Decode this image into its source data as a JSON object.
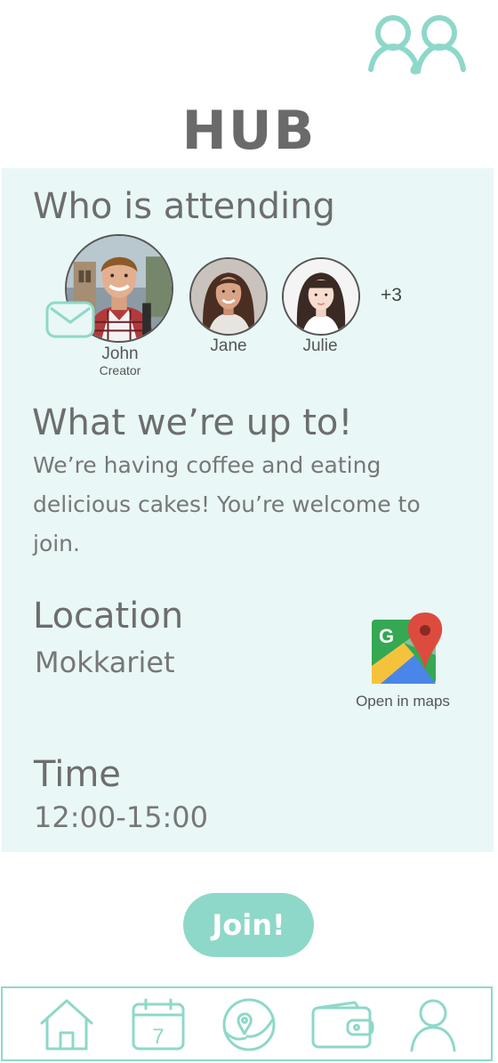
{
  "header": {
    "title": "HUB",
    "friends_icon": "people-icon"
  },
  "attending": {
    "heading": "Who is attending",
    "attendees": [
      {
        "name": "John",
        "role": "Creator",
        "icon": "avatar-john"
      },
      {
        "name": "Jane",
        "role": "",
        "icon": "avatar-jane"
      },
      {
        "name": "Julie",
        "role": "",
        "icon": "avatar-julie"
      }
    ],
    "more_count": "+3",
    "message_icon": "envelope-icon"
  },
  "activity": {
    "heading": "What we’re up to!",
    "description": "We’re having coffee and eating delicious cakes! You’re welcome to join."
  },
  "location": {
    "heading": "Location",
    "value": "Mokkariet",
    "maps_icon": "google-maps-icon",
    "maps_label": "Open in maps"
  },
  "time": {
    "heading": "Time",
    "value": "12:00-15:00"
  },
  "join_label": "Join!",
  "nav": {
    "items": [
      {
        "icon": "home-icon",
        "calendar_day": ""
      },
      {
        "icon": "calendar-icon",
        "calendar_day": "7"
      },
      {
        "icon": "map-location-icon",
        "calendar_day": ""
      },
      {
        "icon": "wallet-icon",
        "calendar_day": ""
      },
      {
        "icon": "profile-icon",
        "calendar_day": ""
      }
    ]
  },
  "colors": {
    "accent": "#8ed8c9",
    "card_background": "#e9f7f6",
    "text": "#6b6b6b"
  }
}
